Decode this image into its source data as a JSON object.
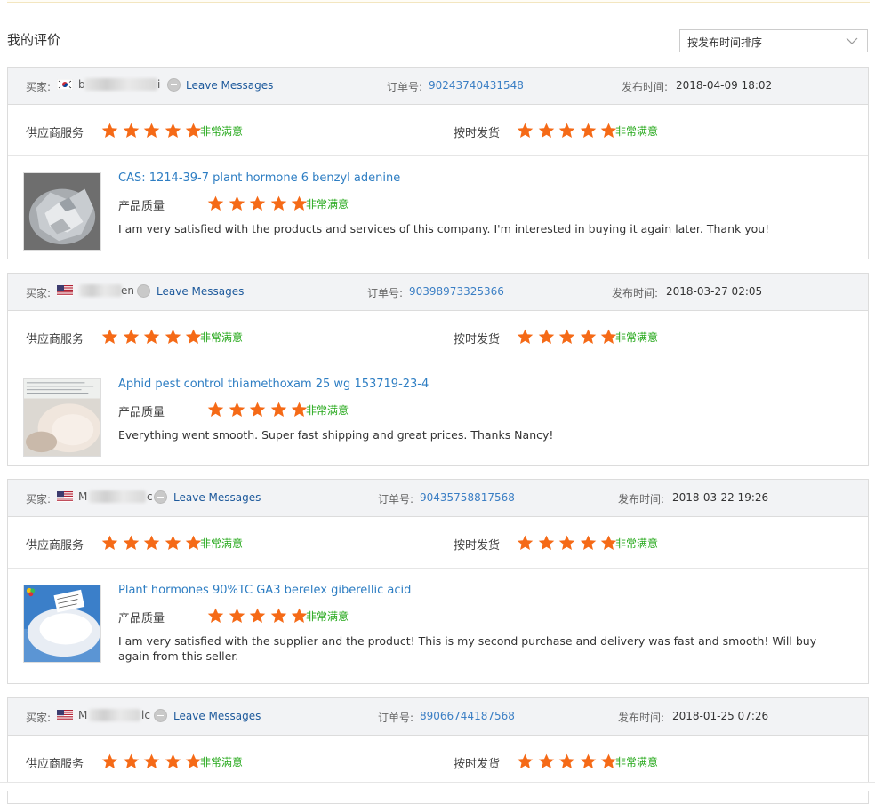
{
  "page": {
    "title": "我的评价"
  },
  "sort": {
    "selected": "按发布时间排序"
  },
  "labels": {
    "buyer": "买家:",
    "leave_messages": "Leave Messages",
    "order_no": "订单号:",
    "published": "发布时间:",
    "supplier_service": "供应商服务",
    "on_time_delivery": "按时发货",
    "product_quality": "产品质量",
    "very_satisfied": "非常满意"
  },
  "colors": {
    "star": "#f56a17",
    "satisfied_text": "#25a81a",
    "link": "#2e7ec3",
    "header_bg": "#f2f3f5"
  },
  "reviews": [
    {
      "buyer_flag": "south-korea-flag",
      "buyer_name_prefix": "b",
      "buyer_name_suffix": "i",
      "order_no": "90243740431548",
      "date": "2018-04-09 18:02",
      "supplier_service_stars": 5,
      "on_time_delivery_stars": 5,
      "product_quality_stars": 5,
      "product_title": "CAS: 1214-39-7 plant hormone 6 benzyl adenine",
      "comment": "I am very satisfied with the products and services of this company. I'm interested in buying it again later. Thank you!",
      "thumb_icon": "foil-bag-powder-image"
    },
    {
      "buyer_flag": "usa-flag",
      "buyer_name_prefix": "",
      "buyer_name_suffix": "en",
      "order_no": "90398973325366",
      "date": "2018-03-27 02:05",
      "supplier_service_stars": 5,
      "on_time_delivery_stars": 5,
      "product_quality_stars": 5,
      "product_title": "Aphid pest control thiamethoxam 25 wg 153719-23-4",
      "comment": "Everything went smooth. Super fast shipping and great prices. Thanks Nancy!",
      "thumb_icon": "granule-powder-image"
    },
    {
      "buyer_flag": "usa-flag",
      "buyer_name_prefix": "M",
      "buyer_name_suffix": "c",
      "order_no": "90435758817568",
      "date": "2018-03-22 19:26",
      "supplier_service_stars": 5,
      "on_time_delivery_stars": 5,
      "product_quality_stars": 5,
      "product_title": "Plant hormones 90%TC GA3 berelex giberellic acid",
      "comment": "I am very satisfied with the supplier and the product! This is my second purchase and delivery was fast and smooth! Will buy again from this seller.",
      "thumb_icon": "white-powder-image"
    },
    {
      "buyer_flag": "usa-flag",
      "buyer_name_prefix": "M",
      "buyer_name_suffix": "lc",
      "order_no": "89066744187568",
      "date": "2018-01-25 07:26",
      "supplier_service_stars": 5,
      "on_time_delivery_stars": 5
    }
  ]
}
